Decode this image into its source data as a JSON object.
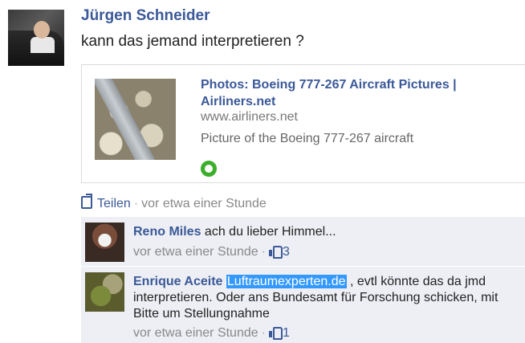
{
  "post": {
    "author": "Jürgen Schneider",
    "text": "kann das jemand interpretieren ?"
  },
  "attachment": {
    "title": "Photos: Boeing 777-267 Aircraft Pictures | Airliners.net",
    "url": "www.airliners.net",
    "description": "Picture of the Boeing 777-267 aircraft",
    "icon": "airliners-logo-icon"
  },
  "actions": {
    "share_label": "Teilen",
    "separator": "·",
    "timestamp": "vor etwa einer Stunde",
    "share_icon": "share-icon"
  },
  "comments": [
    {
      "author": "Reno Miles",
      "text": "ach du lieber Himmel...",
      "timestamp": "vor etwa einer Stunde",
      "separator": "·",
      "likes": "3"
    },
    {
      "author": "Enrique Aceite",
      "link_text": "Luftraumexperten.de",
      "text": ", evtl könnte das da jmd interpretieren. Oder ans Bundesamt für Forschung schicken, mit Bitte um Stellungnahme",
      "timestamp": "vor etwa einer Stunde",
      "separator": "·",
      "likes": "1"
    }
  ],
  "colors": {
    "link_blue": "#3b5998",
    "comment_bg": "#edeff4",
    "selection": "#3399ff"
  }
}
